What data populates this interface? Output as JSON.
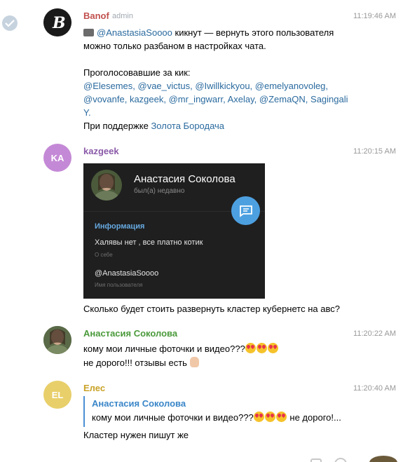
{
  "messages": {
    "m1": {
      "name": "Banof",
      "role": "admin",
      "time": "11:19:46 AM",
      "line1_pre": "🔫 ",
      "line1_mention": "@AnastasiaSoooo",
      "line1_post": " кикнут — вернуть этого пользователя",
      "line2": "можно только разбаном в настройках чата.",
      "voted_label": "Проголосовавшие за кик:",
      "voters_line1": "@Elesemes, @vae_victus, @Iwillkickyou, @emelyanovoleg,",
      "voters_line2": "@vovanfe, kazgeek, @mr_ingwarr, Axelay, @ZemaQN, Sagingali",
      "voters_line3": "Y.",
      "support_pre": "При поддержке ",
      "support_link": "Золота Бородача"
    },
    "m2": {
      "initials": "KA",
      "name": "kazgeek",
      "time": "11:20:15 AM",
      "card": {
        "name": "Анастасия Соколова",
        "status": "был(а) недавно",
        "info_label": "Информация",
        "bio": "Халявы нет , все платно котик",
        "bio_label": "О себе",
        "username": "@AnastasiaSoooo",
        "username_label": "Имя пользователя"
      },
      "text": "Сколько будет стоить развернуть кластер кубернетс на авс?"
    },
    "m3": {
      "name": "Анастасия Соколова",
      "time": "11:20:22 AM",
      "line1": "кому мои личные фоточки и видео???",
      "line2": "не дорого!!! отзывы есть"
    },
    "m4": {
      "initials": "EL",
      "name": "Елес",
      "time": "11:20:40 AM",
      "reply_name": "Анастасия Соколова",
      "reply_text_pre": "кому мои личные фоточки и видео???",
      "reply_text_post": " не дорого!...",
      "text": "Кластер нужен пишут же"
    }
  },
  "colors": {
    "admin_name": "#c0504d",
    "kazgeek_name": "#8a5aa8",
    "anastasia_name": "#4a9a3a",
    "eles_name": "#c9a227",
    "avatar_ka": "#c489d6",
    "avatar_el": "#e8cf6a",
    "link": "#2a6a9e"
  },
  "icons": [
    "check-icon",
    "pistol-icon",
    "heart-eyes-emoji",
    "ok-hand-emoji",
    "chat-bubble-icon"
  ]
}
